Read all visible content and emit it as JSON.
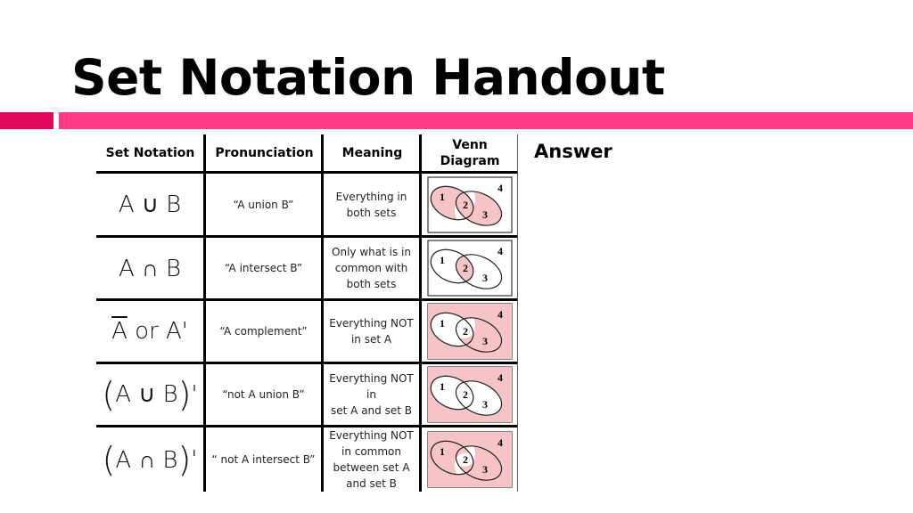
{
  "slide": {
    "title": "Set Notation Handout",
    "answer_label": "Answer",
    "accent_colors": {
      "bar_dark": "#e2075a",
      "bar_light": "#ff3a87",
      "venn_fill": "#f6c3c6"
    }
  },
  "table": {
    "headers": [
      "Set Notation",
      "Pronunciation",
      "Meaning",
      "Venn Diagram"
    ],
    "rows": [
      {
        "notation": "A ∪ B",
        "pronunciation": "“A union B”",
        "meaning": [
          "Everything in",
          "both sets"
        ],
        "shaded_regions": [
          1,
          2,
          3
        ]
      },
      {
        "notation": "A ∩ B",
        "pronunciation": "“A intersect B”",
        "meaning": [
          "Only what is in",
          "common with",
          "both sets"
        ],
        "shaded_regions": [
          2
        ]
      },
      {
        "notation": "A or A'",
        "pronunciation": "“A complement”",
        "meaning": [
          "Everything NOT",
          "in set A"
        ],
        "shaded_regions": [
          3,
          4
        ]
      },
      {
        "notation": "(A ∪ B)'",
        "pronunciation": "“not A union B”",
        "meaning": [
          "Everything NOT",
          "in",
          "set A and set B"
        ],
        "shaded_regions": [
          4
        ]
      },
      {
        "notation": "(A ∩ B)'",
        "pronunciation": "“ not A intersect B”",
        "meaning": [
          "Everything NOT",
          "in common",
          "between set A",
          "and set B"
        ],
        "shaded_regions": [
          1,
          3,
          4
        ]
      }
    ],
    "venn_labels": [
      "1",
      "2",
      "3",
      "4"
    ]
  }
}
